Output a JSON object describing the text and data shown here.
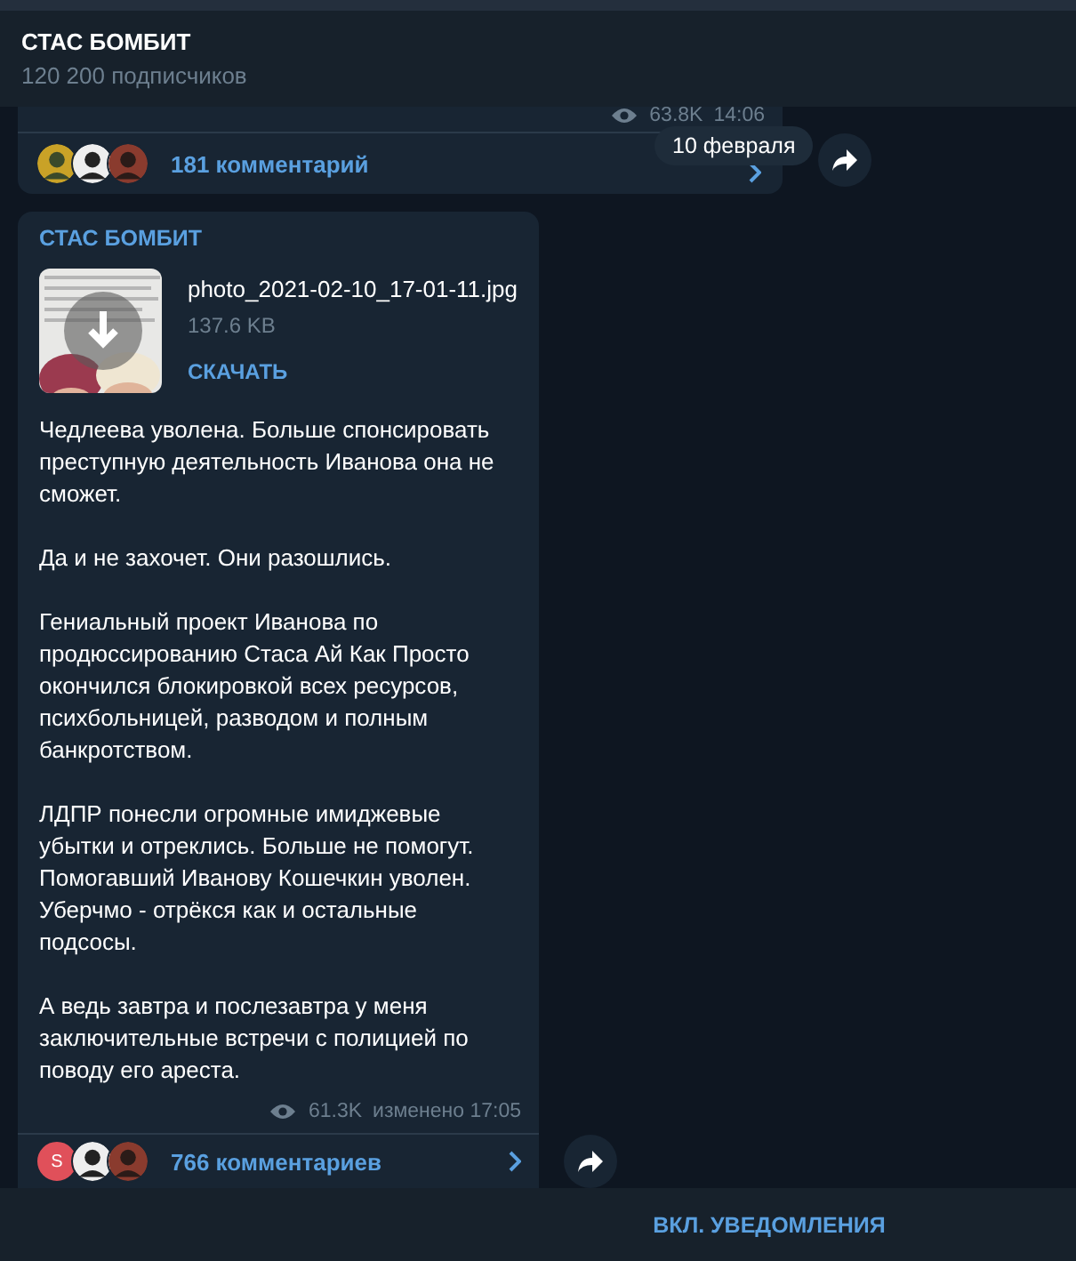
{
  "header": {
    "title": "СТАС БОМБИТ",
    "subtitle": "120 200 подписчиков"
  },
  "previous_post": {
    "views": "63.8K",
    "time": "14:06",
    "comments": "181 комментарий",
    "avatars": [
      {
        "kind": "picture"
      },
      {
        "kind": "picture"
      },
      {
        "kind": "picture"
      }
    ]
  },
  "date_pill": "10 февраля",
  "post": {
    "author": "СТАС БОМБИТ",
    "file": {
      "name": "photo_2021-02-10_17-01-11.jpg",
      "size": "137.6 KB",
      "action": "СКАЧАТЬ"
    },
    "paragraphs": [
      "Чедлеева уволена. Больше спонсировать преступную деятельность Иванова она не сможет.",
      "Да и не захочет. Они разошлись.",
      "Гениальный проект Иванова по продюссированию Стаса Ай Как Просто окончился блокировкой всех ресурсов, психбольницей, разводом и полным банкротством.",
      "ЛДПР понесли огромные имиджевые убытки и отреклись. Больше не помогут. Помогавший Иванову Кошечкин уволен. Уберчмо - отрёкся как и остальные подсосы.",
      "А ведь завтра и послезавтра у меня заключительные встречи с полицией по поводу его ареста."
    ],
    "views": "61.3K",
    "time": "изменено 17:05",
    "comments": "766 комментариев",
    "avatars": [
      {
        "kind": "letter",
        "letter": "S",
        "color": "#e0505a"
      },
      {
        "kind": "picture"
      },
      {
        "kind": "picture"
      }
    ]
  },
  "footer_button": "ВКЛ. УВЕДОМЛЕНИЯ"
}
